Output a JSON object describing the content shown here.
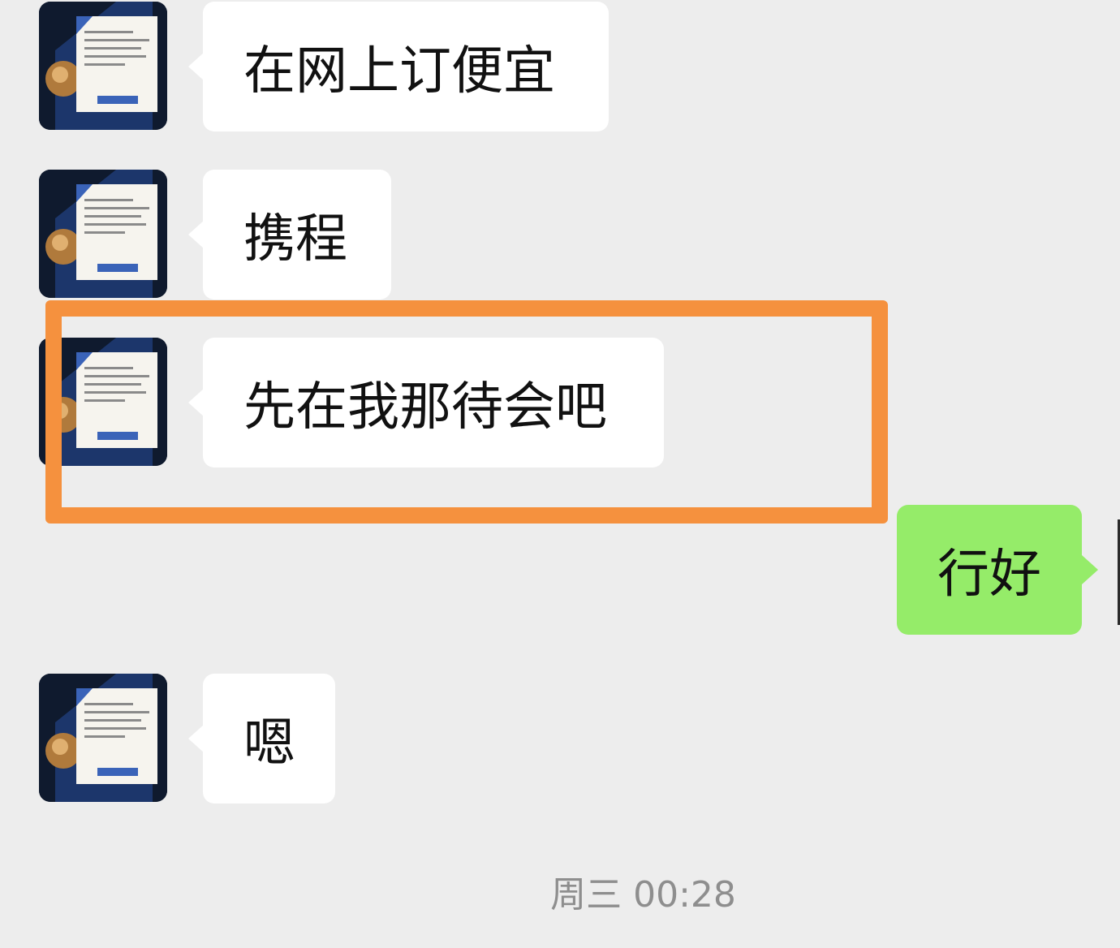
{
  "messages": [
    {
      "side": "left",
      "text": "在网上订便宜"
    },
    {
      "side": "left",
      "text": "携程"
    },
    {
      "side": "left",
      "text": "先在我那待会吧"
    },
    {
      "side": "right",
      "text": "行好"
    },
    {
      "side": "left",
      "text": "嗯"
    }
  ],
  "timestamp": "周三 00:28",
  "colors": {
    "background": "#ededed",
    "incoming_bubble": "#ffffff",
    "outgoing_bubble": "#95ec69",
    "highlight_box": "#f5913e",
    "timestamp_text": "#8e8e8e"
  },
  "icons": {
    "avatar": "contact-avatar-icon"
  }
}
